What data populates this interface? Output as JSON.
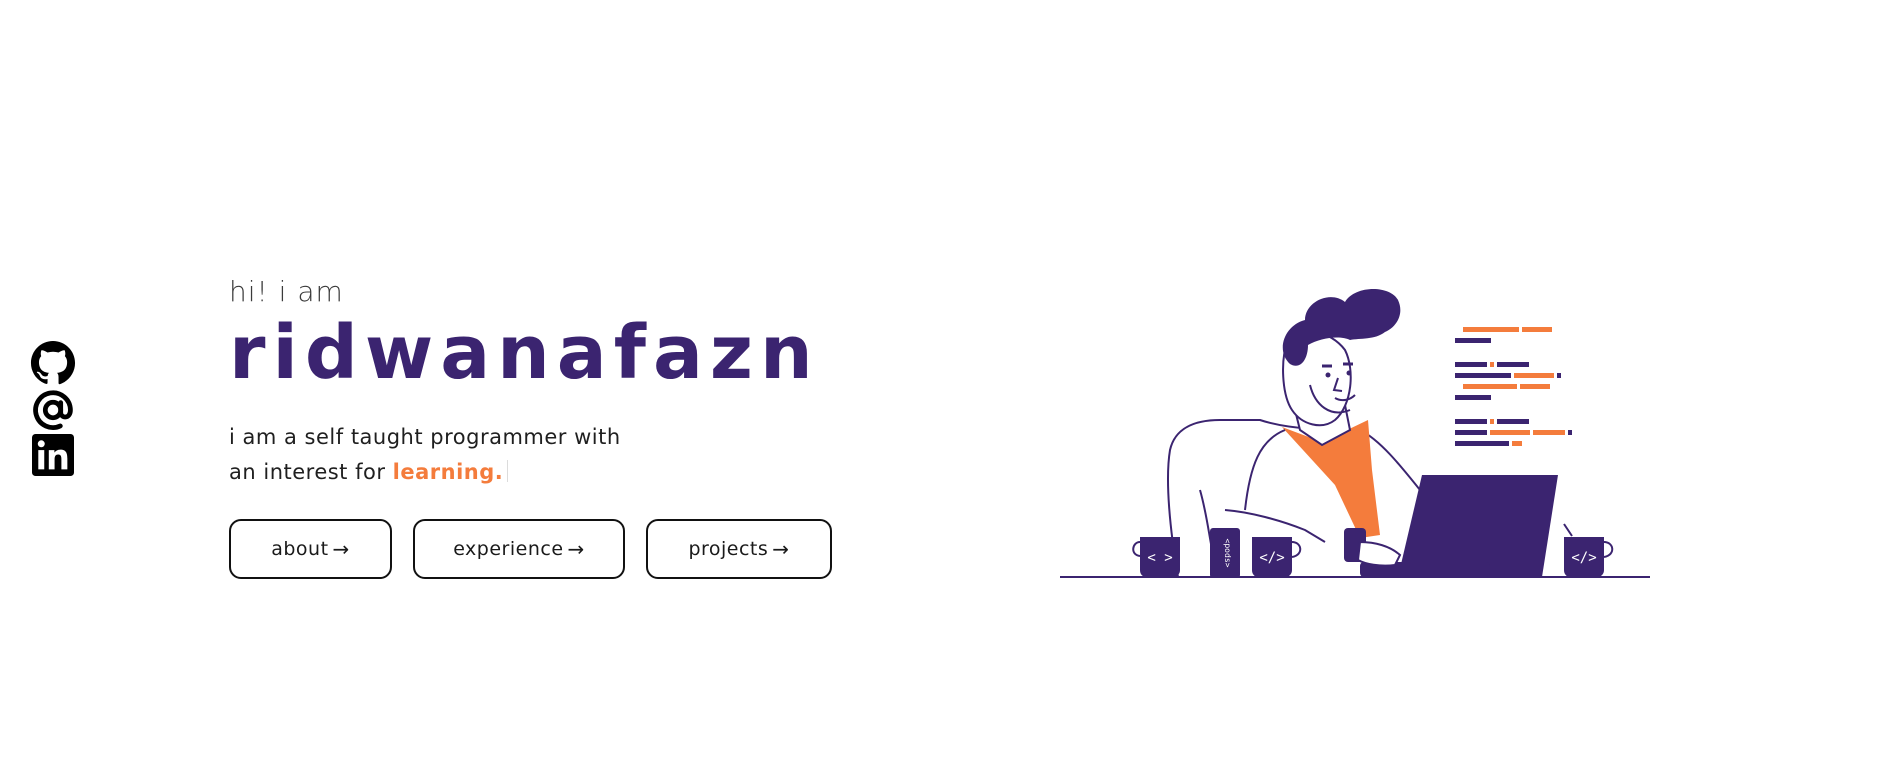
{
  "social": [
    {
      "icon": "github-icon",
      "label": "github"
    },
    {
      "icon": "at-icon",
      "label": "email"
    },
    {
      "icon": "linkedin-icon",
      "label": "linkedin"
    }
  ],
  "hero": {
    "greeting": "hi! i am",
    "name": "ridwanafazn",
    "intro_line1": "i am a self taught programmer with",
    "intro_line2_prefix": "an interest for ",
    "intro_highlight": "learning."
  },
  "buttons": {
    "about": "about",
    "experience": "experience",
    "projects": "projects",
    "arrow": "→"
  },
  "illustration": {
    "mug_left_text": "< >",
    "can_text": "<pods>",
    "mug_mid_text": "</>",
    "mug_right_text": "</>"
  },
  "colors": {
    "primary": "#3b2470",
    "accent": "#f47c3c"
  }
}
